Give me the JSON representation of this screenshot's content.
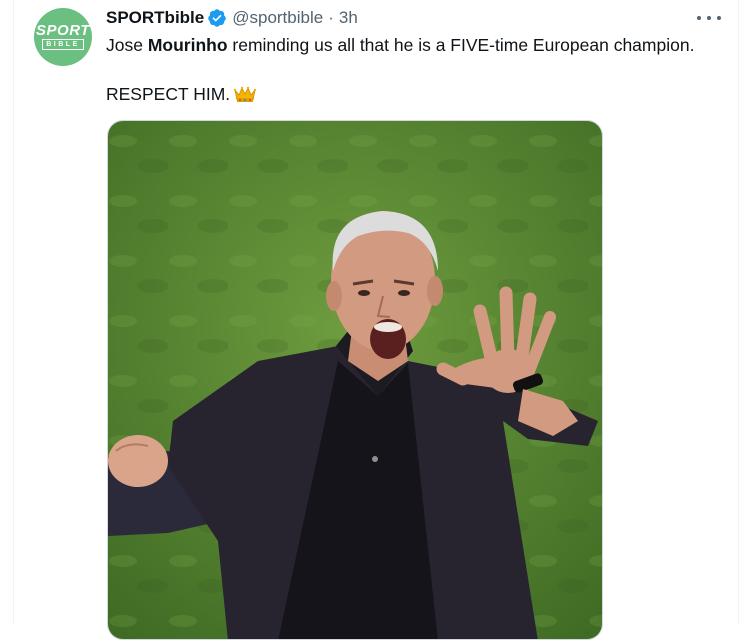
{
  "tweet": {
    "display_name": "SPORTbible",
    "handle": "@sportbible",
    "separator": "·",
    "time": "3h",
    "text_line1_pre": "Jose ",
    "text_line1_bold": "Mourinho",
    "text_line1_post": " reminding us all that he is a FIVE-time European champion.",
    "text_line2": "RESPECT HIM."
  },
  "avatar": {
    "top_text": "SPORT",
    "bottom_text": "BIBLE"
  },
  "icons": {
    "verified": "verified-badge-icon",
    "more": "more-horizontal-icon",
    "emoji": "crown-emoji"
  },
  "colors": {
    "avatar_green": "#6abf81",
    "verified_blue": "#1d9bf0",
    "secondary_text": "#536471",
    "pitch_green": "#5a8a32"
  }
}
